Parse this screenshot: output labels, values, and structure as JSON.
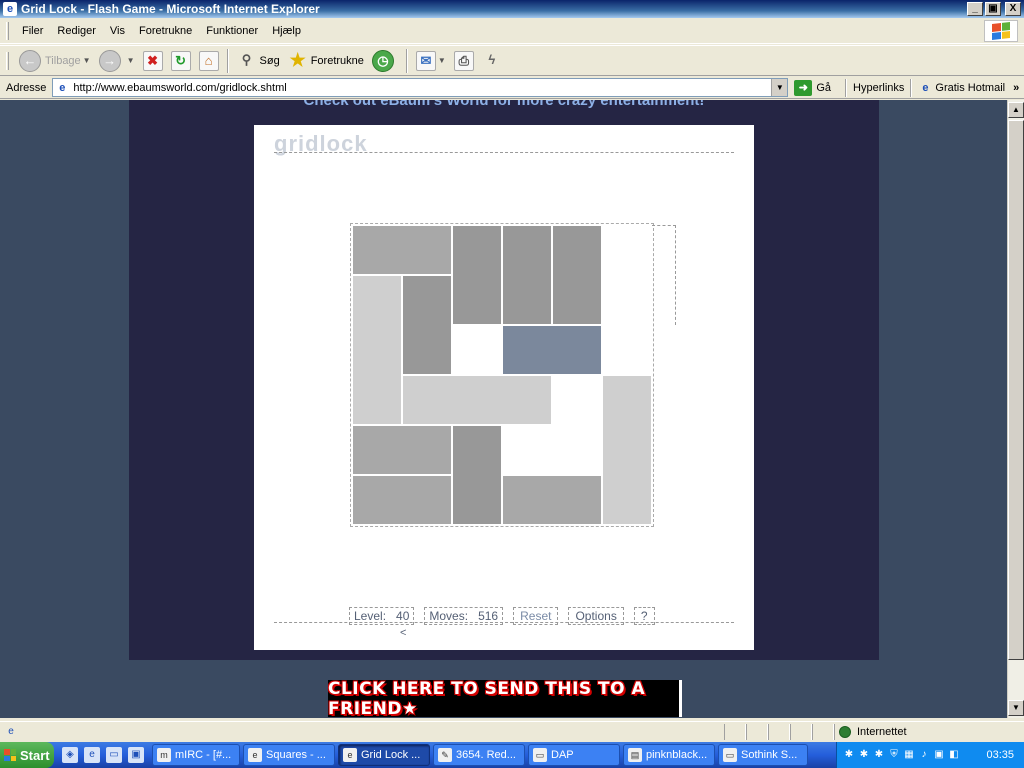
{
  "window": {
    "title": "Grid Lock - Flash Game - Microsoft Internet Explorer",
    "minimize": "_",
    "maximize": "▣",
    "close": "X"
  },
  "menubar": {
    "items": [
      "Filer",
      "Rediger",
      "Vis",
      "Foretrukne",
      "Funktioner",
      "Hjælp"
    ]
  },
  "toolbar": {
    "back_label": "Tilbage",
    "search_label": "Søg",
    "favorites_label": "Foretrukne"
  },
  "addressbar": {
    "label": "Adresse",
    "url": "http://www.ebaumsworld.com/gridlock.shtml",
    "go_label": "Gå",
    "links_label": "Hyperlinks",
    "hotmail_label": "Gratis Hotmail",
    "more": "»"
  },
  "page": {
    "promo_text": "Check out eBaum's World for more crazy entertainment!",
    "banner_text": "CLICK HERE TO SEND THIS TO A FRIEND★"
  },
  "game": {
    "logo": "gridlock",
    "level_label": "Level:",
    "level_value": "40",
    "moves_label": "Moves:",
    "moves_value": "516",
    "reset_label": "Reset",
    "options_label": "Options",
    "help_label": "?",
    "back_symbol": "<"
  },
  "statusbar": {
    "zone": "Internettet"
  },
  "taskbar": {
    "start_label": "Start",
    "tasks": [
      {
        "label": "mIRC - [#...",
        "active": false
      },
      {
        "label": "Squares - ...",
        "active": false
      },
      {
        "label": "Grid Lock ...",
        "active": true
      },
      {
        "label": "3654. Red...",
        "active": false
      },
      {
        "label": "DAP",
        "active": false
      },
      {
        "label": "pinknblack...",
        "active": false
      },
      {
        "label": "Sothink S...",
        "active": false
      }
    ],
    "clock": "03:35"
  },
  "colors": {
    "page_background": "#3a4a61",
    "frame_background": "#252544",
    "target_block": "#7b889c",
    "taskbar": "#245edb"
  }
}
